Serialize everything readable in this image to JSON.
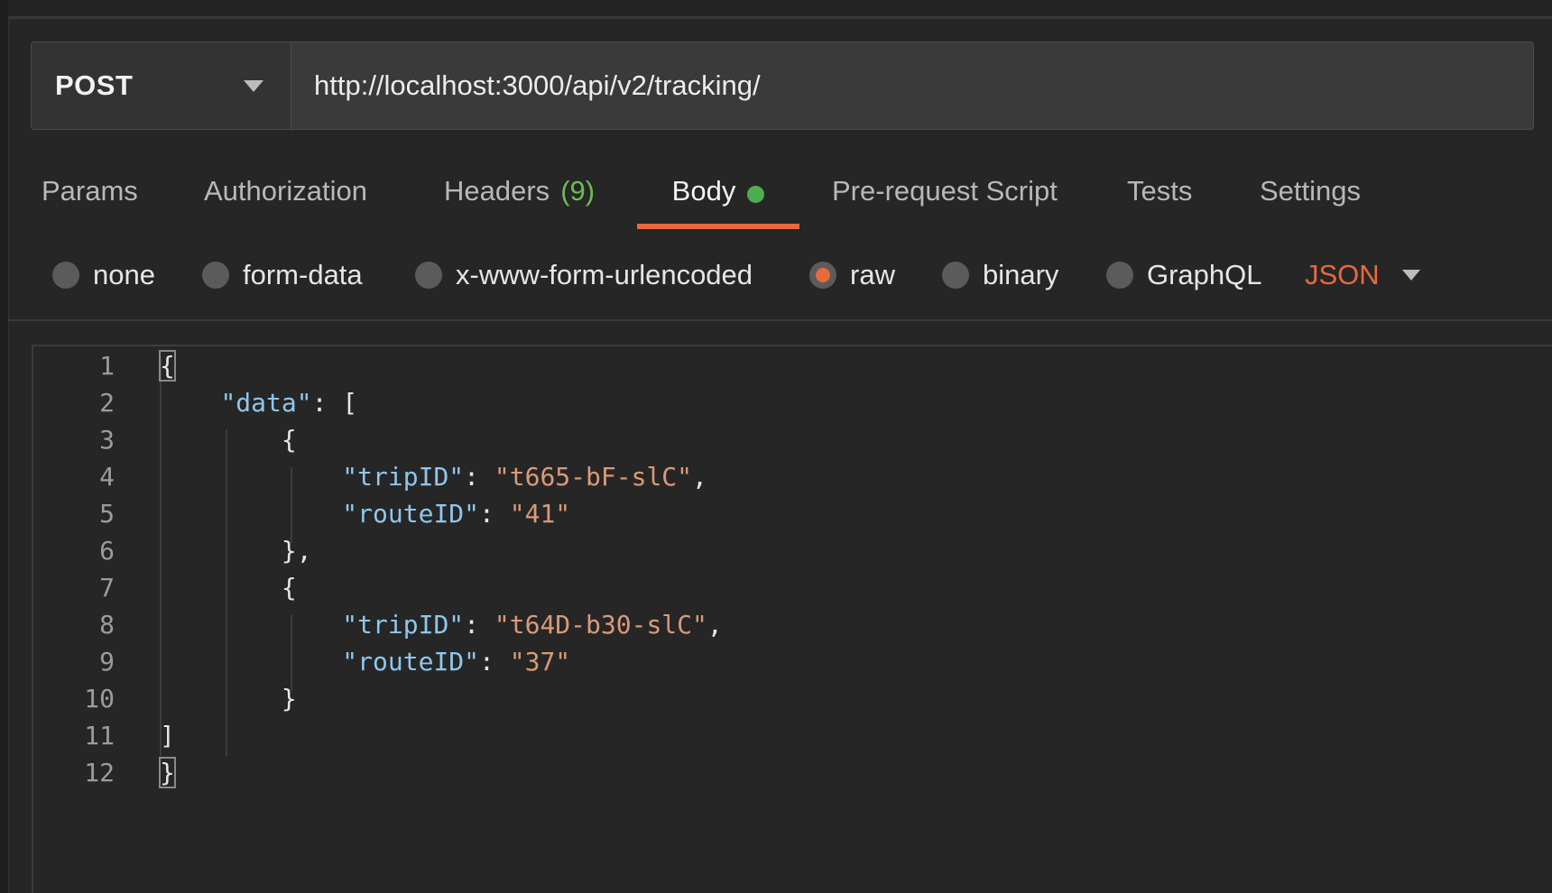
{
  "request": {
    "method": "POST",
    "url": "http://localhost:3000/api/v2/tracking/"
  },
  "tabs": [
    {
      "label": "Params"
    },
    {
      "label": "Authorization"
    },
    {
      "label": "Headers",
      "count": "(9)"
    },
    {
      "label": "Body",
      "active": true
    },
    {
      "label": "Pre-request Script"
    },
    {
      "label": "Tests"
    },
    {
      "label": "Settings"
    }
  ],
  "body_types": [
    {
      "label": "none",
      "selected": false
    },
    {
      "label": "form-data",
      "selected": false
    },
    {
      "label": "x-www-form-urlencoded",
      "selected": false
    },
    {
      "label": "raw",
      "selected": true
    },
    {
      "label": "binary",
      "selected": false
    },
    {
      "label": "GraphQL",
      "selected": false
    }
  ],
  "language": "JSON",
  "editor": {
    "line_numbers": [
      "1",
      "2",
      "3",
      "4",
      "5",
      "6",
      "7",
      "8",
      "9",
      "10",
      "11",
      "12"
    ],
    "lines": [
      "{",
      "    \"data\": [",
      "        {",
      "            \"tripID\": \"t665-bF-slC\",",
      "            \"routeID\": \"41\"",
      "        },",
      "        {",
      "            \"tripID\": \"t64D-b30-slC\",",
      "            \"routeID\": \"37\"",
      "        }",
      "]",
      "}"
    ]
  },
  "colors": {
    "accent": "#e8693e",
    "status_dot": "#4dae4f",
    "count_green": "#6dbb56",
    "json_key": "#8fc7ec",
    "json_string": "#d99a78",
    "background": "#262626"
  }
}
